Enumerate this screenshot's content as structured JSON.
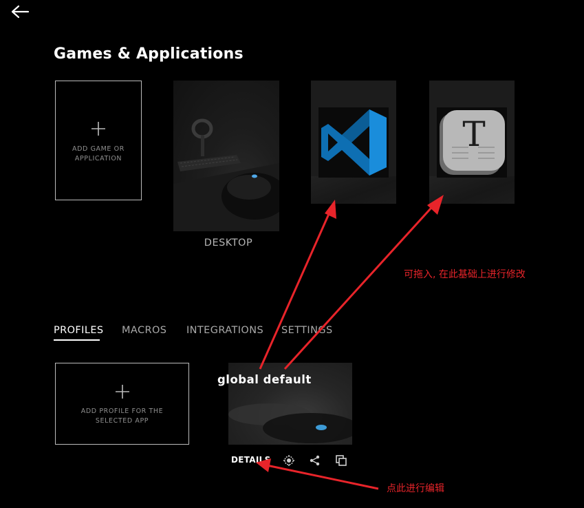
{
  "header": {
    "back_icon": "arrow-left-icon",
    "title": "Games & Applications"
  },
  "apps": {
    "add_label_line1": "ADD GAME OR",
    "add_label_line2": "APPLICATION",
    "items": [
      {
        "name": "DESKTOP",
        "icon": "desktop-scene-image"
      },
      {
        "name": "",
        "icon": "vscode-icon"
      },
      {
        "name": "",
        "icon": "typora-icon"
      }
    ]
  },
  "tabs": [
    {
      "label": "PROFILES",
      "active": true
    },
    {
      "label": "MACROS",
      "active": false
    },
    {
      "label": "INTEGRATIONS",
      "active": false
    },
    {
      "label": "SETTINGS",
      "active": false
    }
  ],
  "profiles": {
    "add_label_line1": "ADD PROFILE FOR THE",
    "add_label_line2": "SELECTED APP",
    "items": [
      {
        "name": "global default",
        "details_label": "DETAILS",
        "actions": [
          "persistent-gear-icon",
          "share-icon",
          "duplicate-icon"
        ]
      }
    ]
  },
  "annotations": {
    "drag_note": "可拖入, 在此基础上进行修改",
    "edit_note": "点此进行编辑",
    "color": "#e8242a"
  },
  "colors": {
    "background": "#000000",
    "card": "#1c1c1c",
    "muted_text": "#a9a9a9",
    "accent_annotation": "#e8242a"
  }
}
